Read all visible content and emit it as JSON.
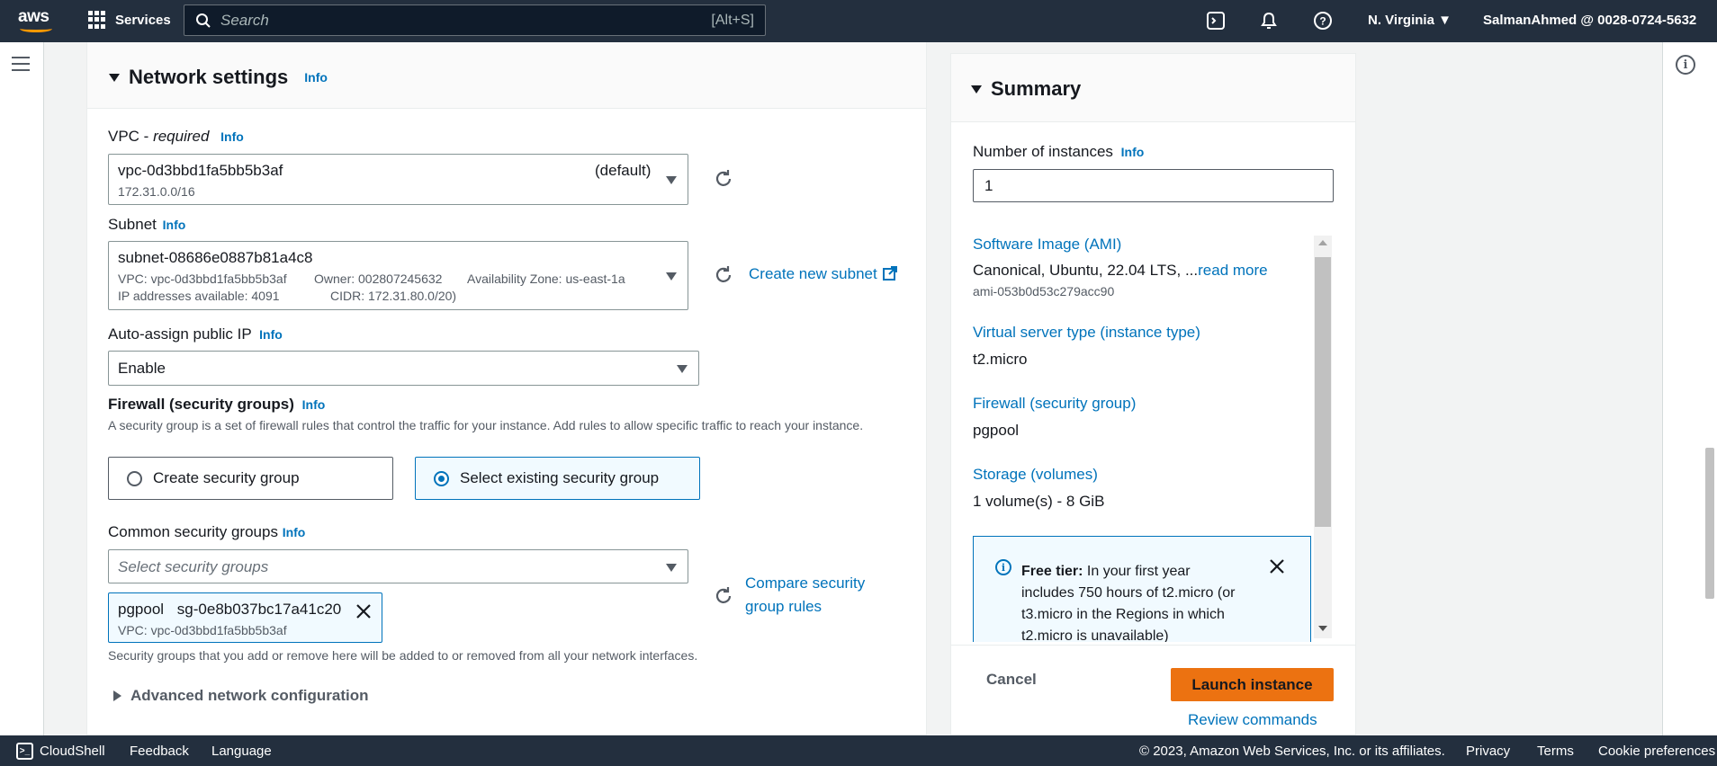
{
  "topnav": {
    "logo_text": "aws",
    "services_label": "Services",
    "search_placeholder": "Search",
    "search_shortcut": "[Alt+S]",
    "region": "N. Virginia ▼",
    "account": "SalmanAhmed @ 0028-0724-5632"
  },
  "network": {
    "title": "Network settings",
    "info": "Info",
    "vpc_label": "VPC - ",
    "vpc_required": "required",
    "vpc_value": "vpc-0d3bbd1fa5bb5b3af",
    "vpc_default": "(default)",
    "vpc_cidr": "172.31.0.0/16",
    "subnet_label": "Subnet",
    "subnet_value": "subnet-08686e0887b81a4c8",
    "subnet_vpc": "VPC: vpc-0d3bbd1fa5bb5b3af",
    "subnet_owner": "Owner: 002807245632",
    "subnet_az": "Availability Zone: us-east-1a",
    "subnet_ips": "IP addresses available: 4091",
    "subnet_cidr": "CIDR: 172.31.80.0/20)",
    "create_subnet": "Create new subnet",
    "auto_ip_label": "Auto-assign public IP",
    "auto_ip_value": "Enable",
    "firewall_label": "Firewall (security groups)",
    "firewall_desc": "A security group is a set of firewall rules that control the traffic for your instance. Add rules to allow specific traffic to reach your instance.",
    "create_sg": "Create security group",
    "select_sg": "Select existing security group",
    "common_sg_label": "Common security groups",
    "common_sg_placeholder": "Select security groups",
    "compare_link": "Compare security group rules",
    "token_name": "pgpool",
    "token_id": "sg-0e8b037bc17a41c20",
    "token_vpc": "VPC: vpc-0d3bbd1fa5bb5b3af",
    "sg_note": "Security groups that you add or remove here will be added to or removed from all your network interfaces.",
    "advanced": "Advanced network configuration"
  },
  "summary": {
    "title": "Summary",
    "num_label": "Number of instances",
    "num_value": "1",
    "ami_link": "Software Image (AMI)",
    "ami_value": "Canonical, Ubuntu, 22.04 LTS, ...",
    "read_more": "read more",
    "ami_id": "ami-053b0d53c279acc90",
    "type_link": "Virtual server type (instance type)",
    "type_value": "t2.micro",
    "fw_link": "Firewall (security group)",
    "fw_value": "pgpool",
    "storage_link": "Storage (volumes)",
    "storage_value": "1 volume(s) - 8 GiB",
    "free_bold": "Free tier:",
    "free_text": " In your first year includes 750 hours of t2.micro (or t3.micro in the Regions in which t2.micro is unavailable)",
    "cancel": "Cancel",
    "launch": "Launch instance",
    "review": "Review commands"
  },
  "footer": {
    "cloudshell": "CloudShell",
    "feedback": "Feedback",
    "language": "Language",
    "copyright": "© 2023, Amazon Web Services, Inc. or its affiliates.",
    "privacy": "Privacy",
    "terms": "Terms",
    "cookies": "Cookie preferences"
  },
  "colors": {
    "nav_bg": "#232f3e",
    "link": "#0073bb",
    "primary_button": "#ec7211"
  }
}
